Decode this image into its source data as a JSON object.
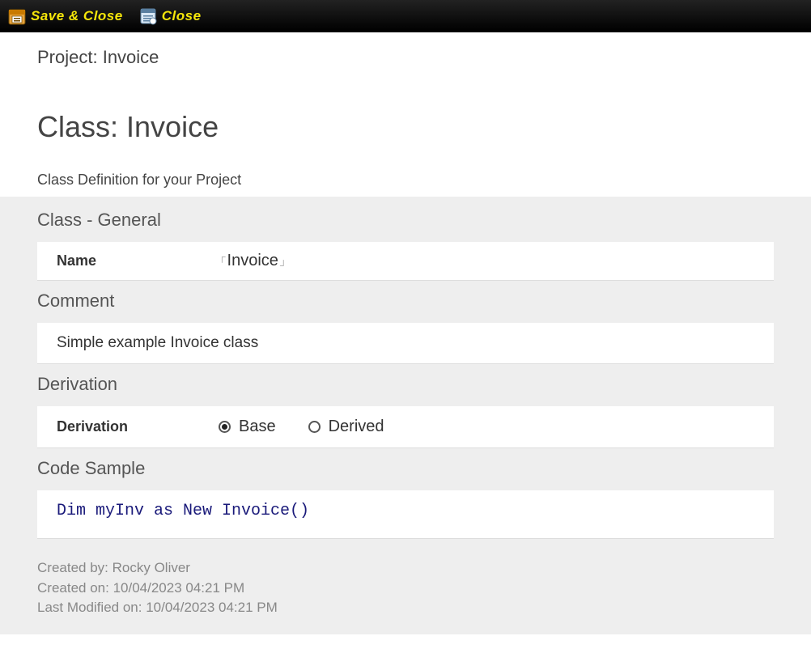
{
  "toolbar": {
    "save_close_label": "Save & Close",
    "close_label": "Close"
  },
  "header": {
    "project_prefix": "Project: ",
    "project_name": "Invoice",
    "class_prefix": "Class: ",
    "class_name": "Invoice",
    "class_def_sub": "Class Definition for your Project"
  },
  "sections": {
    "general_heading": "Class - General",
    "name_label": "Name",
    "name_value": "Invoice",
    "comment_heading": "Comment",
    "comment_value": "Simple example Invoice class",
    "derivation_heading": "Derivation",
    "derivation_label": "Derivation",
    "derivation_options": {
      "base": "Base",
      "derived": "Derived"
    },
    "derivation_selected": "base",
    "code_sample_heading": "Code Sample",
    "code_sample_value": "Dim myInv as New Invoice()"
  },
  "meta": {
    "created_by_label": "Created by: ",
    "created_by": "Rocky Oliver",
    "created_on_label": "Created on: ",
    "created_on": "10/04/2023 04:21 PM",
    "modified_on_label": "Last Modified on: ",
    "modified_on": "10/04/2023 04:21 PM"
  }
}
